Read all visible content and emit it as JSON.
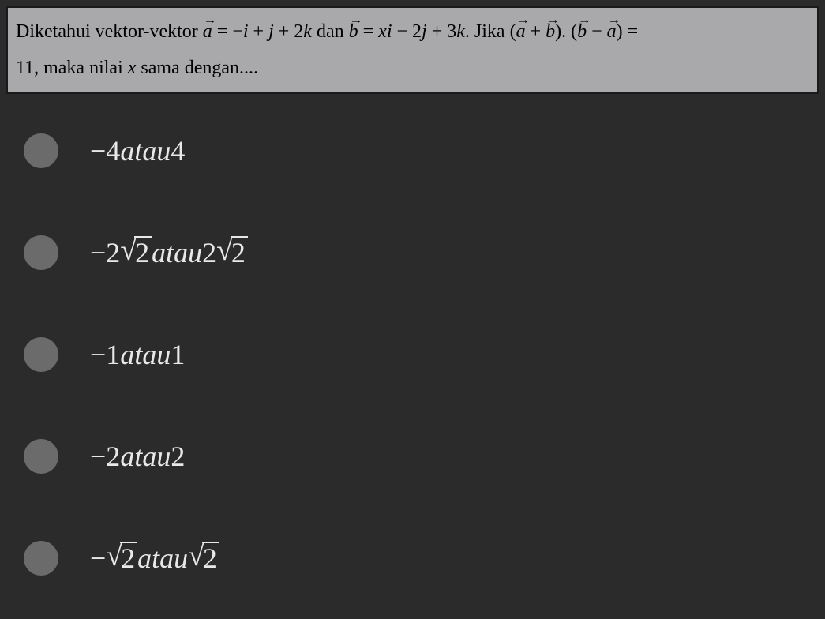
{
  "question": {
    "prefix": "Diketahui  vektor-vektor ",
    "a_var": "a",
    "a_eq": " = −",
    "i": "i",
    "plus1": " + ",
    "j": "j",
    "plus2": " + 2",
    "k": "k",
    "dan": "  dan  ",
    "b_var": "b",
    "b_eq": " = ",
    "x": "x",
    "i2": "i",
    "minus1": " − 2",
    "j2": "j",
    "plus3": " + 3",
    "k2": "k",
    "jika": ".  Jika  (",
    "a2": "a",
    "plus4": " + ",
    "b2": "b",
    "dot": "). (",
    "b3": "b",
    "minus2": " − ",
    "a3": "a",
    "close": ") =",
    "line2_val": "11",
    "line2_text": ", maka nilai ",
    "x2": "x",
    "line2_end": " sama dengan...."
  },
  "options": {
    "opt1": {
      "neg": "−4 ",
      "atau": "atau",
      "pos": " 4"
    },
    "opt2": {
      "neg": "−2",
      "sqrt_arg": "2",
      "atau": " atau ",
      "pos": "2",
      "sqrt_arg2": "2"
    },
    "opt3": {
      "neg": "−1 ",
      "atau": "atau",
      "pos": " 1"
    },
    "opt4": {
      "neg": "−2 ",
      "atau": "atau",
      "pos": " 2"
    },
    "opt5": {
      "neg": "−",
      "sqrt_arg": "2",
      "atau": " atau ",
      "sqrt_arg2": "2"
    }
  }
}
